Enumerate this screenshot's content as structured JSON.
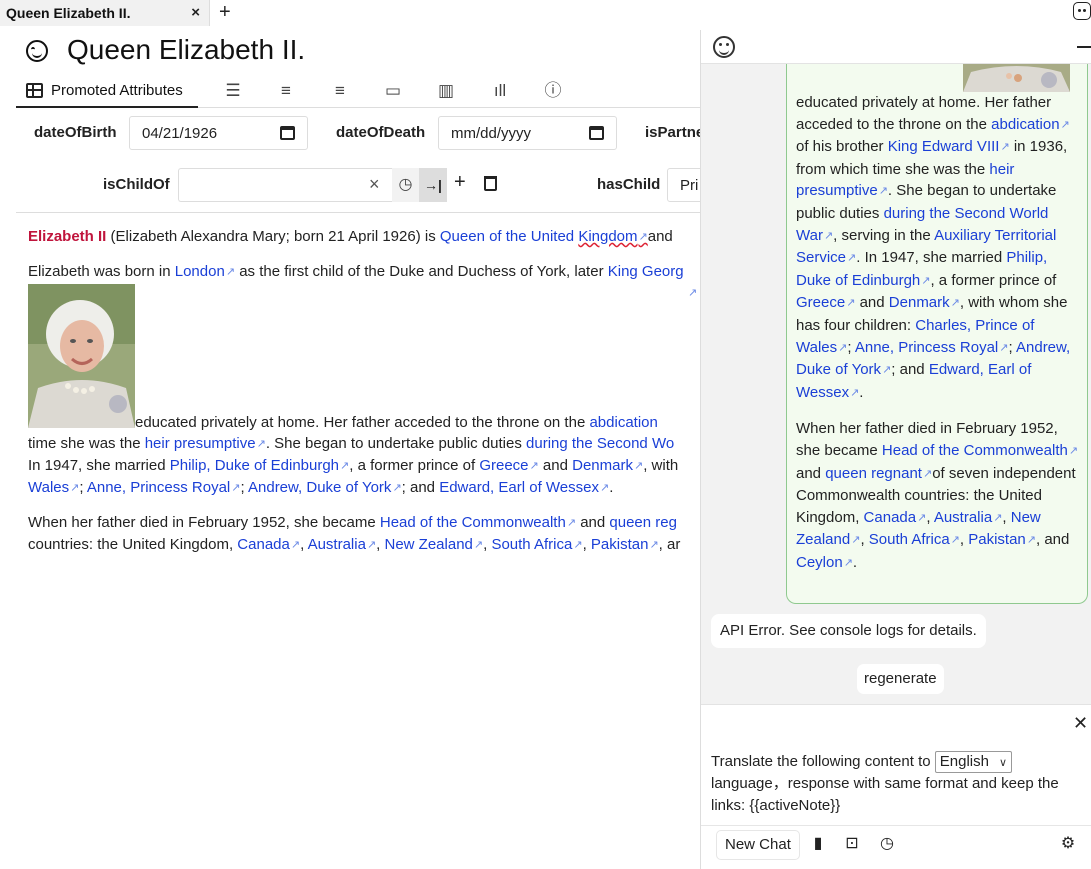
{
  "tab": {
    "title": "Queen Elizabeth II.",
    "close": "×",
    "new_tab": "+"
  },
  "note": {
    "title": "Queen Elizabeth II."
  },
  "ribbon": {
    "active_tab_label": "Promoted Attributes",
    "icons": [
      "sliders-icon",
      "checklist-icon",
      "list-add-icon",
      "stack-icon",
      "map-icon",
      "bar-chart-icon",
      "info-icon"
    ]
  },
  "attributes": {
    "dateOfBirth": {
      "label": "dateOfBirth",
      "value": "04/21/1926"
    },
    "dateOfDeath": {
      "label": "dateOfDeath",
      "placeholder": "mm/dd/yyyy"
    },
    "isPartner": {
      "label": "isPartne"
    },
    "isChildOf": {
      "label": "isChildOf",
      "value": ""
    },
    "hasChild": {
      "label": "hasChild",
      "value": "Pri"
    }
  },
  "content": {
    "p1": {
      "name": "Elizabeth II",
      "t1": " (Elizabeth Alexandra Mary; born 21 April 1926) is ",
      "l1": "Queen of the United ",
      "l1b": "Kingdom",
      "t2": "and"
    },
    "p2": {
      "t1": "Elizabeth was born in ",
      "l1": "London",
      "t2": " as the first child of the Duke and Duchess of York, later ",
      "l2": "King Georg"
    },
    "p3": {
      "t1": " educated privately at home. Her father acceded to the throne on the ",
      "l1": "abdication"
    },
    "p4": {
      "t1": "time she was the ",
      "l1": "heir presumptive",
      "t2": ". She began to undertake public duties ",
      "l2": "during the Second Wo"
    },
    "p5": {
      "t1": "In 1947, she married ",
      "l1": "Philip, Duke of Edinburgh",
      "t2": ", a former prince of ",
      "l2": "Greece",
      "t3": " and ",
      "l3": "Denmark",
      "t4": ", with"
    },
    "p6": {
      "l1": "Wales",
      "t1": "; ",
      "l2": "Anne, Princess Royal",
      "t2": "; ",
      "l3": "Andrew, Duke of York",
      "t3": "; and ",
      "l4": "Edward, Earl of Wessex",
      "t4": "."
    },
    "p7": {
      "t1": "When her father died in February 1952, she became ",
      "l1": "Head of the Commonwealth",
      "t2": " and ",
      "l2": "queen reg"
    },
    "p8": {
      "t1": "countries: the United Kingdom, ",
      "l1": "Canada",
      "t2": ", ",
      "l2": "Australia",
      "t3": ", ",
      "l3": "New Zealand",
      "t4": ", ",
      "l4": "South Africa",
      "t5": ", ",
      "l5": "Pakistan",
      "t6": ", ar"
    }
  },
  "panel": {
    "bubble": {
      "a1": "educated privately at home. Her father acceded to the throne on the ",
      "a2": "abdication",
      "a3": " of his brother ",
      "a4": "King Edward VIII",
      "a5": " in 1936, from which time she was the ",
      "a6": "heir presumptive",
      "a7": ". She began to undertake public duties ",
      "a8": "during the Second World War",
      "a9": ", serving in the ",
      "a10": "Auxiliary Territorial Service",
      "a11": ". In 1947, she married ",
      "a12": "Philip, Duke of Edinburgh",
      "a13": ", a former prince of ",
      "a14": "Greece",
      "a15": " and ",
      "a16": "Denmark",
      "a17": ", with whom she has four children: ",
      "a18": "Charles, Prince of Wales",
      "a19": "; ",
      "a20": "Anne, Princess Royal",
      "a21": "; ",
      "a22": "Andrew, Duke of York",
      "a23": "; and ",
      "a24": "Edward, Earl of Wessex",
      "a25": ".",
      "b1": "When her father died in February 1952, she became ",
      "b2": "Head of the Commonwealth",
      "b3": " and ",
      "b4": "queen regnant",
      "b5": "of seven independent Commonwealth countries: the United Kingdom, ",
      "b6": "Canada",
      "b7": ", ",
      "b8": "Australia",
      "b9": ", ",
      "b10": "New Zealand",
      "b11": ", ",
      "b12": "South Africa",
      "b13": ", ",
      "b14": "Pakistan",
      "b15": ", and ",
      "b16": "Ceylon",
      "b17": "."
    },
    "api_error": "API Error. See console logs for details.",
    "regenerate": "regenerate",
    "prompt_pre": "Translate the following content to ",
    "language": "English",
    "prompt_post": "language，response with same format and keep the links: {{activeNote}}",
    "new_chat": "New Chat"
  },
  "colors": {
    "link": "#1a3fd6",
    "name_red": "#c0143c",
    "bubble_border": "#8fc98f"
  }
}
